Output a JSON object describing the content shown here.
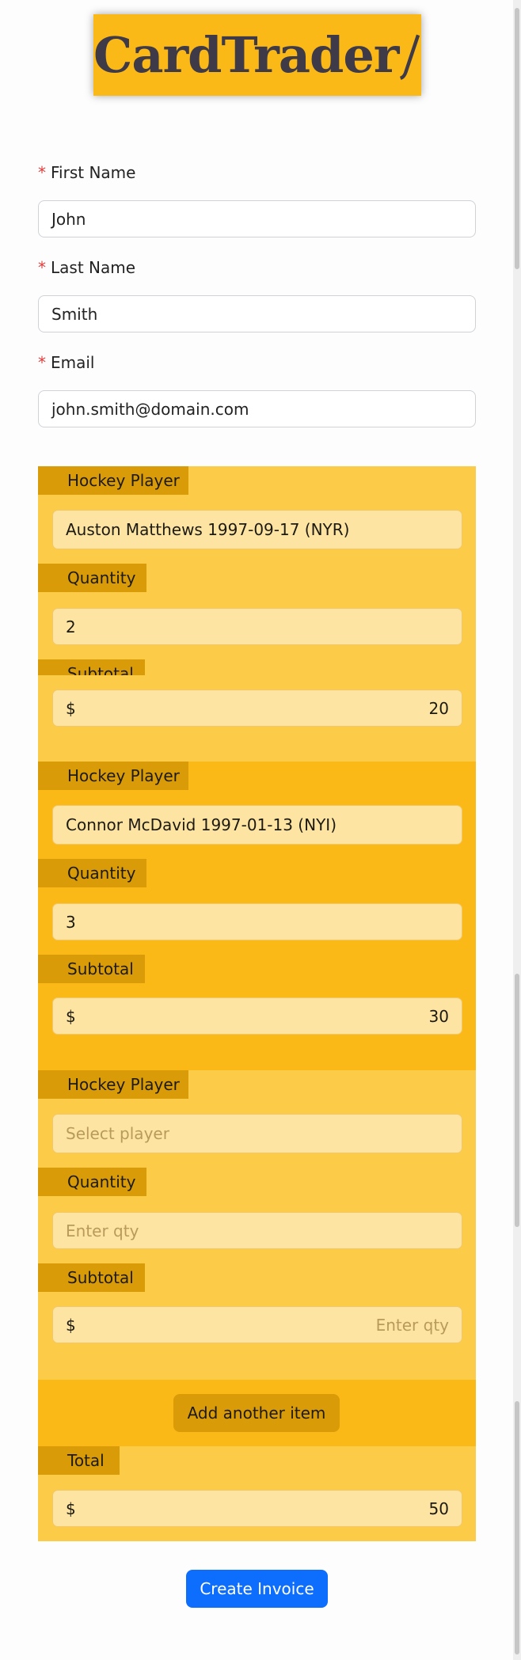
{
  "brand": {
    "logo_text": "CardTrader"
  },
  "form": {
    "first_name": {
      "label": "First Name",
      "value": "John",
      "required": "*"
    },
    "last_name": {
      "label": "Last Name",
      "value": "Smith",
      "required": "*"
    },
    "email": {
      "label": "Email",
      "value": "john.smith@domain.com",
      "required": "*"
    }
  },
  "items": [
    {
      "player_label": "Hockey Player",
      "player_value": "Auston Matthews 1997-09-17 (NYR)",
      "qty_label": "Quantity",
      "qty_value": "2",
      "subtotal_label": "Subtotal",
      "currency": "$",
      "subtotal_value": "20"
    },
    {
      "player_label": "Hockey Player",
      "player_value": "Connor McDavid 1997-01-13 (NYI)",
      "qty_label": "Quantity",
      "qty_value": "3",
      "subtotal_label": "Subtotal",
      "currency": "$",
      "subtotal_value": "30"
    },
    {
      "player_label": "Hockey Player",
      "player_placeholder": "Select player",
      "qty_label": "Quantity",
      "qty_placeholder": "Enter qty",
      "subtotal_label": "Subtotal",
      "currency": "$",
      "subtotal_placeholder": "Enter qty"
    }
  ],
  "add_item_label": "Add another item",
  "total": {
    "label": "Total",
    "currency": "$",
    "value": "50"
  },
  "submit_label": "Create Invoice",
  "colors": {
    "accent": "#fbb917",
    "light": "#fccb48",
    "tag": "#d99c08",
    "button": "#0d6efd"
  }
}
